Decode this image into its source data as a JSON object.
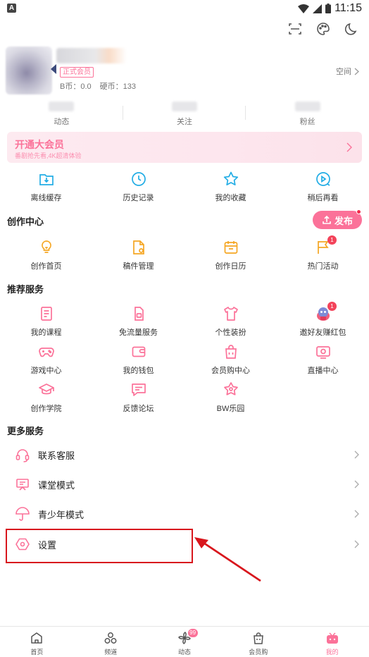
{
  "status_bar": {
    "left_badge": "A",
    "time": "11:15"
  },
  "profile": {
    "member_badge": "正式会员",
    "b_coins": "B币：0.0",
    "hard_coins": "硬币：133",
    "space_link": "空间"
  },
  "stats": [
    {
      "label": "动态"
    },
    {
      "label": "关注"
    },
    {
      "label": "粉丝"
    }
  ],
  "vip_banner": {
    "title": "开通大会员",
    "subtitle": "番剧抢先看,4K超清体验"
  },
  "quick_actions": [
    {
      "label": "离线缓存",
      "icon": "download-folder-icon"
    },
    {
      "label": "历史记录",
      "icon": "clock-history-icon"
    },
    {
      "label": "我的收藏",
      "icon": "star-icon"
    },
    {
      "label": "稍后再看",
      "icon": "play-later-icon"
    }
  ],
  "creation_center": {
    "title": "创作中心",
    "publish_label": "发布",
    "items": [
      {
        "label": "创作首页",
        "icon": "lightbulb-icon"
      },
      {
        "label": "稿件管理",
        "icon": "manuscript-icon"
      },
      {
        "label": "创作日历",
        "icon": "calendar-icon"
      },
      {
        "label": "热门活动",
        "icon": "flag-icon",
        "badge": "1"
      }
    ]
  },
  "recommended_services": {
    "title": "推荐服务",
    "items": [
      {
        "label": "我的课程",
        "icon": "course-book-icon"
      },
      {
        "label": "免流量服务",
        "icon": "sim-card-icon"
      },
      {
        "label": "个性装扮",
        "icon": "tshirt-icon"
      },
      {
        "label": "邀好友赚红包",
        "icon": "invite-mascot-icon",
        "badge": "1"
      },
      {
        "label": "游戏中心",
        "icon": "gamepad-icon"
      },
      {
        "label": "我的钱包",
        "icon": "wallet-icon"
      },
      {
        "label": "会员购中心",
        "icon": "shopping-bag-icon"
      },
      {
        "label": "直播中心",
        "icon": "live-tv-icon"
      },
      {
        "label": "创作学院",
        "icon": "graduation-cap-icon"
      },
      {
        "label": "反馈论坛",
        "icon": "feedback-chat-icon"
      },
      {
        "label": "BW乐园",
        "icon": "bw-star-icon"
      }
    ]
  },
  "more_services": {
    "title": "更多服务",
    "items": [
      {
        "label": "联系客服",
        "icon": "headset-icon"
      },
      {
        "label": "课堂模式",
        "icon": "classroom-board-icon"
      },
      {
        "label": "青少年模式",
        "icon": "umbrella-icon"
      },
      {
        "label": "设置",
        "icon": "settings-hexagon-icon"
      }
    ]
  },
  "bottom_nav": [
    {
      "label": "首页",
      "icon": "home-icon"
    },
    {
      "label": "频道",
      "icon": "channels-icon"
    },
    {
      "label": "动态",
      "icon": "pinwheel-icon",
      "badge": "99"
    },
    {
      "label": "会员购",
      "icon": "shop-bag-icon"
    },
    {
      "label": "我的",
      "icon": "tv-mine-icon",
      "active": true
    }
  ],
  "colors": {
    "accent": "#fb7299",
    "annotation": "#d8161d"
  }
}
